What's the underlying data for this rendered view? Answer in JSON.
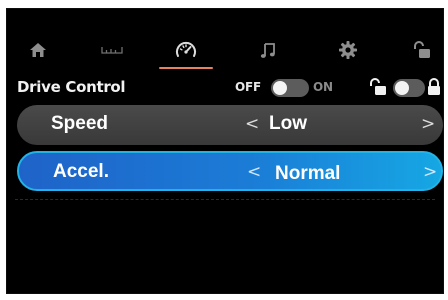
{
  "tabs": [
    {
      "name": "home-icon"
    },
    {
      "name": "ruler-icon"
    },
    {
      "name": "speedometer-icon",
      "active": true
    },
    {
      "name": "music-note-icon"
    },
    {
      "name": "gear-icon"
    },
    {
      "name": "unlock-icon"
    }
  ],
  "drive_control": {
    "title": "Drive Control",
    "off_label": "OFF",
    "on_label": "ON",
    "toggle_state": "off",
    "lock_toggle_state": "off"
  },
  "settings": [
    {
      "label": "Speed",
      "value": "Low",
      "left_arrow": "<",
      "right_arrow": ">"
    },
    {
      "label": "Accel.",
      "value": "Normal",
      "left_arrow": "<",
      "right_arrow": ">"
    }
  ],
  "colors": {
    "accent": "#e8825d",
    "highlight_row": "#1b7cd6",
    "highlight_border": "#23b3e6",
    "row": "#414141",
    "background": "#000000"
  }
}
